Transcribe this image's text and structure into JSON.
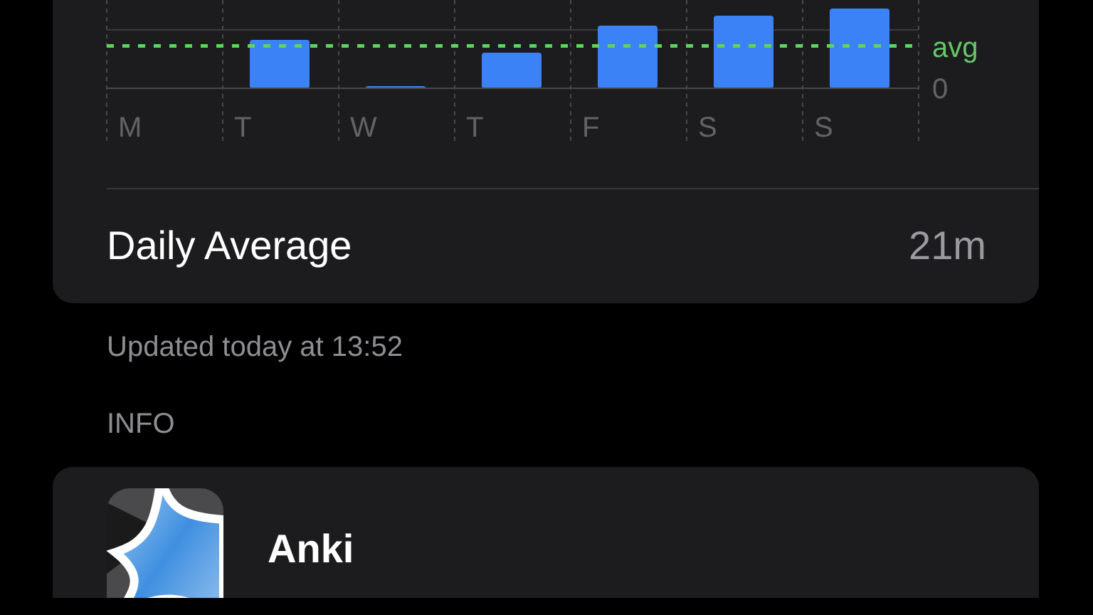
{
  "chart": {
    "day_labels": [
      "M",
      "T",
      "W",
      "T",
      "F",
      "S",
      "S"
    ],
    "avg_label": "avg",
    "zero_label": "0"
  },
  "summary": {
    "label": "Daily Average",
    "value": "21m"
  },
  "updated": "Updated today at 13:52",
  "section_header": "INFO",
  "app": {
    "name": "Anki"
  }
}
